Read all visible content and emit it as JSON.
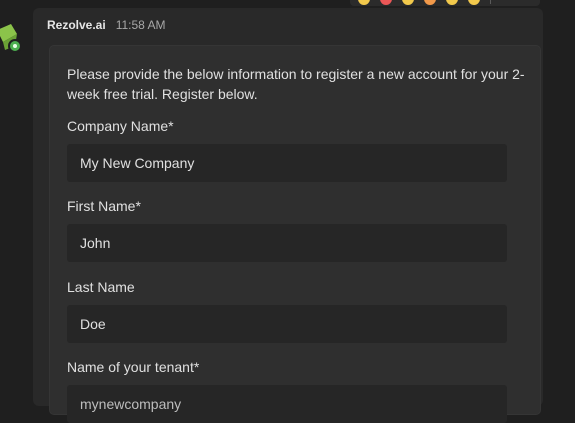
{
  "message": {
    "sender": "Rezolve.ai",
    "time": "11:58 AM"
  },
  "card": {
    "intro": "Please provide the below information to register a new account for your 2-week free trial. Register below.",
    "fields": [
      {
        "label": "Company Name*",
        "value": "My New Company"
      },
      {
        "label": "First Name*",
        "value": "John"
      },
      {
        "label": "Last Name",
        "value": "Doe"
      },
      {
        "label": "Name of your tenant*",
        "value": "mynewcompany"
      }
    ]
  },
  "icons": {
    "avatar": "bot-avatar-icon",
    "reactions": [
      "reaction-icon",
      "reaction-icon",
      "reaction-icon",
      "reaction-icon",
      "reaction-icon",
      "reaction-icon"
    ]
  },
  "colors": {
    "background": "#1f1f1f",
    "message_bubble": "#292929",
    "card": "#2f2f2f",
    "input": "#262626",
    "avatar_green": "#8bc34a"
  }
}
